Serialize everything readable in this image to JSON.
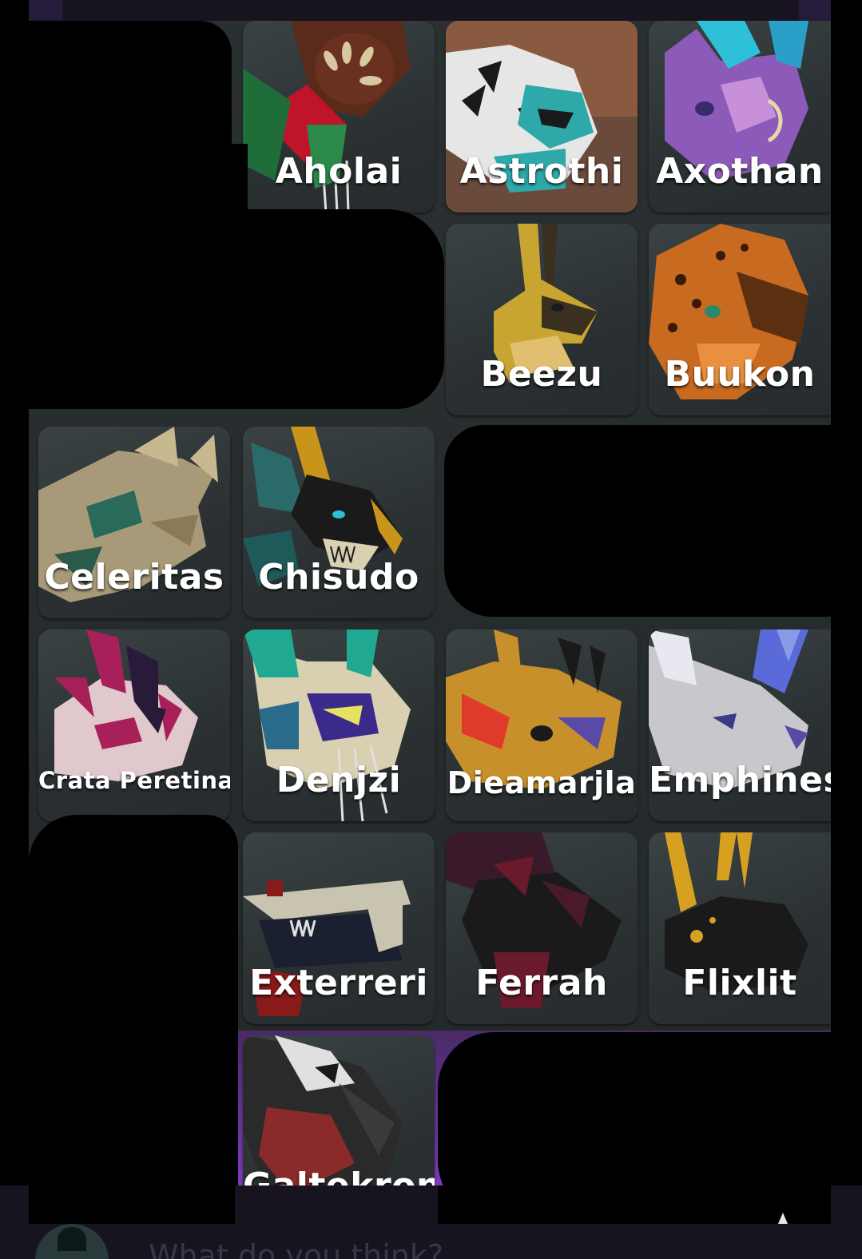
{
  "roster": {
    "tiles": [
      {
        "label": "Aholai",
        "colors": [
          "#1f6e3a",
          "#c0142a",
          "#5a2a1a"
        ]
      },
      {
        "label": "Astrothi",
        "colors": [
          "#9a6a50",
          "#2ea8a8",
          "#e6e6e6"
        ]
      },
      {
        "label": "Axothan",
        "colors": [
          "#8c5ab8",
          "#2ec0d8",
          "#c890d8"
        ]
      },
      {
        "label": "Beezu",
        "colors": [
          "#c8a430",
          "#3a3020",
          "#e0c070"
        ]
      },
      {
        "label": "Buukon",
        "colors": [
          "#c86a20",
          "#5a3010",
          "#e89040"
        ]
      },
      {
        "label": "Celeritas",
        "colors": [
          "#a89a78",
          "#2a6a5a",
          "#c8b890"
        ]
      },
      {
        "label": "Chisudo",
        "colors": [
          "#c8941a",
          "#1a1a1a",
          "#2a8a8a"
        ]
      },
      {
        "label": "Crata Peretina",
        "colors": [
          "#e0c8cc",
          "#a8205a",
          "#2a1a3a"
        ]
      },
      {
        "label": "Denjzi",
        "colors": [
          "#d8d0b0",
          "#3a2a8a",
          "#20a890"
        ]
      },
      {
        "label": "Dieamarjla",
        "colors": [
          "#c8902a",
          "#e03a2a",
          "#1a1a1a"
        ]
      },
      {
        "label": "Emphines",
        "colors": [
          "#c8c8cc",
          "#5a6ad8",
          "#e8e8f0"
        ]
      },
      {
        "label": "Exterreri",
        "colors": [
          "#c8c4b0",
          "#1a2030",
          "#8a1a1a"
        ]
      },
      {
        "label": "Ferrah",
        "colors": [
          "#3a1a2a",
          "#6a1a2a",
          "#1a1a1a"
        ]
      },
      {
        "label": "Flixlit",
        "colors": [
          "#1a1a1a",
          "#d8a020",
          "#2a2a2a"
        ]
      },
      {
        "label": "Galtekron",
        "colors": [
          "#e0e0e0",
          "#8a2a2a",
          "#2a2a2a"
        ]
      }
    ]
  },
  "footer": {
    "prompt_text": "What do you think?"
  }
}
